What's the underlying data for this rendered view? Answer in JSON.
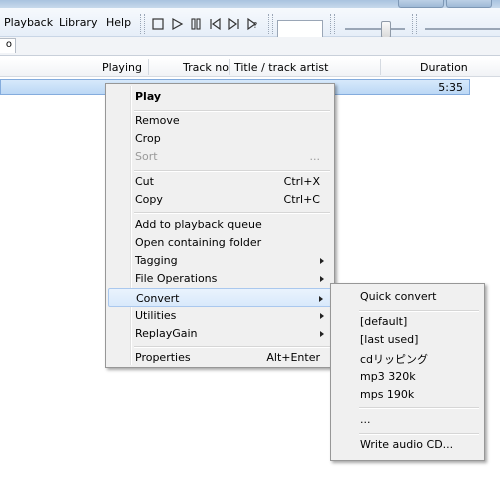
{
  "menubar": {
    "items": [
      "Playback",
      "Library",
      "Help"
    ]
  },
  "toolbar": {
    "buttons": [
      "stop-icon",
      "play-icon",
      "pause-icon",
      "previous-icon",
      "next-icon",
      "random-icon"
    ]
  },
  "tab": {
    "label": "o"
  },
  "columns": [
    "Playing",
    "Track no",
    "Title / track artist",
    "Duration"
  ],
  "row": {
    "duration": "5:35"
  },
  "context_menu": {
    "play": "Play",
    "remove": "Remove",
    "crop": "Crop",
    "sort": "Sort",
    "sort_more": "...",
    "cut": "Cut",
    "cut_sc": "Ctrl+X",
    "copy": "Copy",
    "copy_sc": "Ctrl+C",
    "add_queue": "Add to playback queue",
    "open_folder": "Open containing folder",
    "tagging": "Tagging",
    "file_ops": "File Operations",
    "convert": "Convert",
    "utilities": "Utilities",
    "replaygain": "ReplayGain",
    "properties": "Properties",
    "properties_sc": "Alt+Enter"
  },
  "convert_submenu": {
    "quick": "Quick convert",
    "default": "[default]",
    "last_used": "[last used]",
    "cd_rip": "cdリッピング",
    "mp3": "mp3 320k",
    "mps": "mps 190k",
    "more": "...",
    "write_cd": "Write audio CD..."
  }
}
